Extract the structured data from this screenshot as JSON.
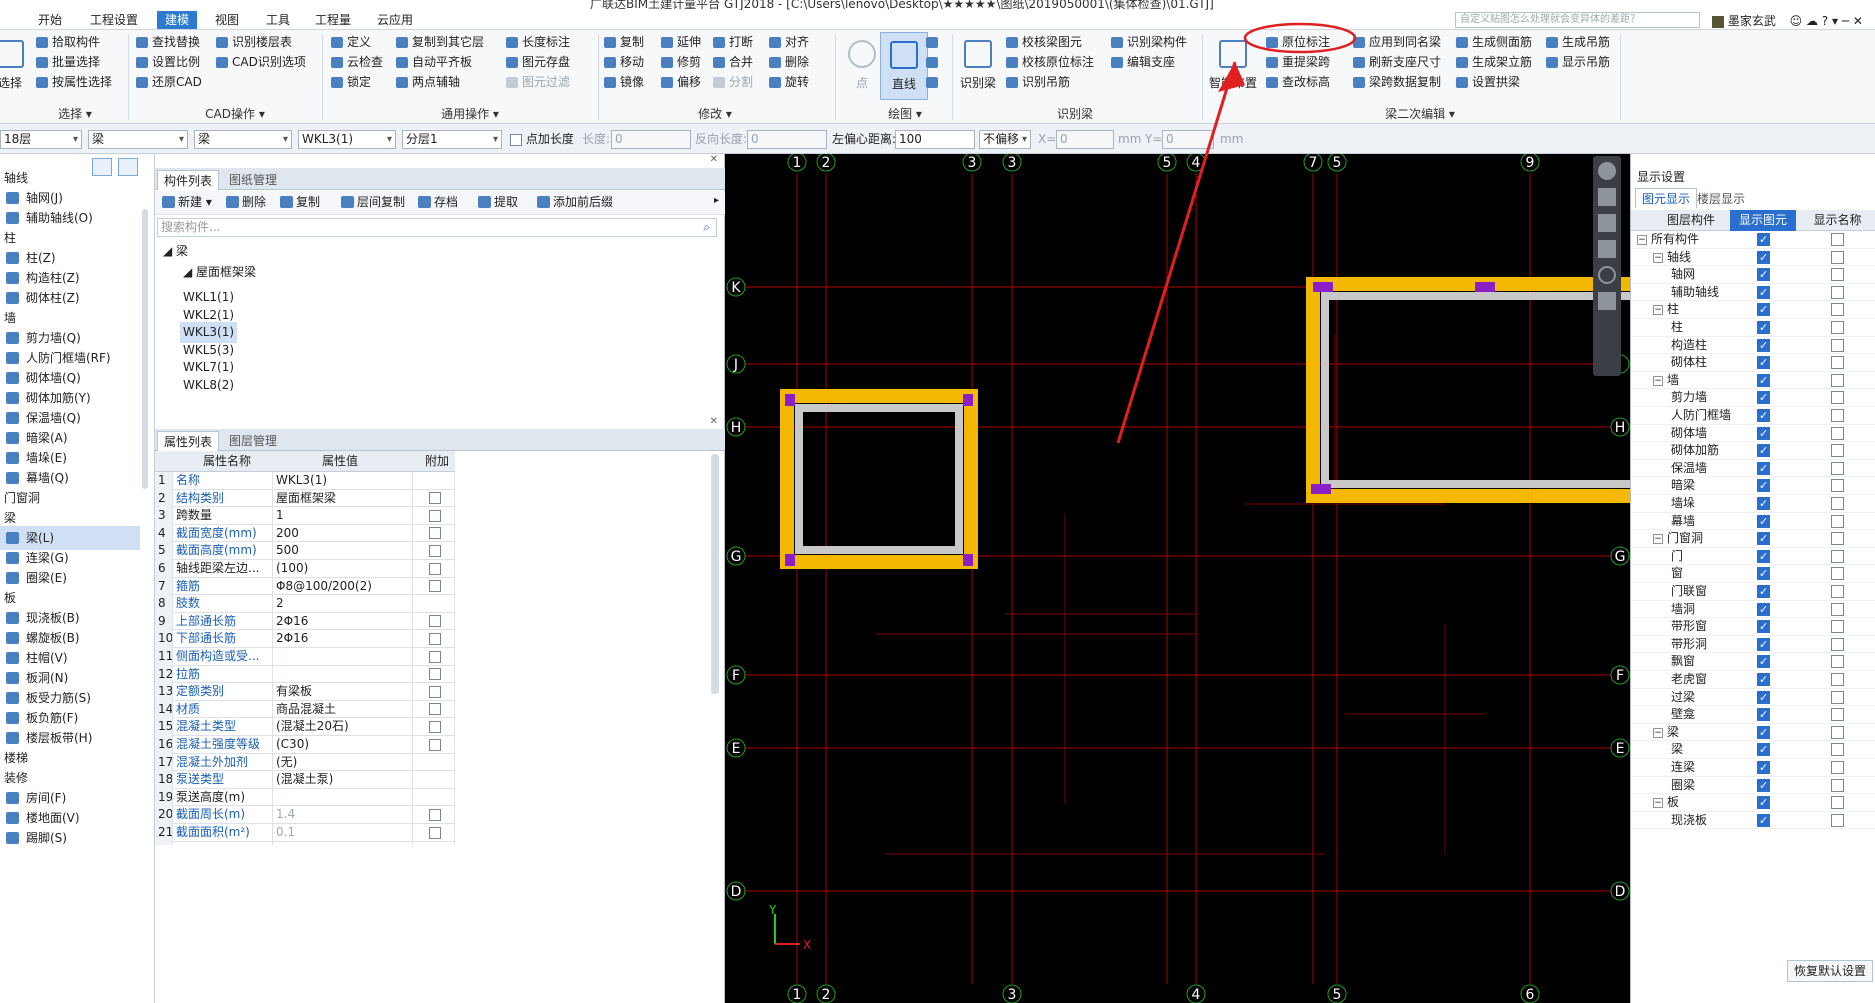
{
  "title_fragment": "广联达BIM土建计量平台 GTJ2018 - [C:\\Users\\lenovo\\Desktop\\★★★★★\\图纸\\2019050001\\(集体检查)\\01.GTJ]",
  "menu": {
    "tabs": [
      "开始",
      "工程设置",
      "建模",
      "视图",
      "工具",
      "工程量",
      "云应用"
    ],
    "active": "建模"
  },
  "search_placeholder": "自定义贴图怎么处理就会变异体的差距？",
  "user": "墨家玄武",
  "ribbon": {
    "select": {
      "big": "选择",
      "items": [
        "拾取构件",
        "批量选择",
        "按属性选择"
      ],
      "group": "选择"
    },
    "cad": {
      "items": [
        "查找替换",
        "设置比例",
        "还原CAD",
        "识别楼层表",
        "CAD识别选项"
      ],
      "group": "CAD操作"
    },
    "common": {
      "items": [
        "定义",
        "云检查",
        "锁定",
        "复制到其它层",
        "自动平齐板",
        "两点辅轴",
        "长度标注",
        "图元存盘",
        "图元过滤"
      ],
      "group": "通用操作"
    },
    "modify": {
      "items": [
        "复制",
        "移动",
        "镜像",
        "延伸",
        "修剪",
        "偏移",
        "打断",
        "合并",
        "分割",
        "对齐",
        "删除",
        "旋转"
      ],
      "group": "修改"
    },
    "draw": {
      "point": "点",
      "line": "直线",
      "group": "绘图"
    },
    "recognize": {
      "big": "识别梁",
      "items": [
        "校核梁图元",
        "校核原位标注",
        "识别吊筋",
        "识别梁构件",
        "编辑支座"
      ],
      "group": "识别梁"
    },
    "beam2": {
      "big": "智能布置",
      "items": [
        "原位标注",
        "重提梁跨",
        "查改标高",
        "应用到同名梁",
        "刷新支座尺寸",
        "梁跨数据复制",
        "生成侧面筋",
        "生成架立筋",
        "设置拱梁",
        "生成吊筋",
        "显示吊筋"
      ],
      "group": "梁二次编辑"
    }
  },
  "selbar": {
    "floor": "18层",
    "type": "梁",
    "subtype": "梁",
    "component": "WKL3(1)",
    "layer": "分层1",
    "addlen_label": "点加长度",
    "len_label": "长度:",
    "len_value": "0",
    "revlen_label": "反向长度:",
    "revlen_value": "0",
    "offset_label": "左偏心距离:",
    "offset_value": "100",
    "nooffset": "不偏移",
    "x_label": "X=",
    "x_value": "0",
    "y_label": "Y=",
    "y_value": "0",
    "unit": "mm"
  },
  "nav": [
    {
      "t": "cat",
      "label": "轴线"
    },
    {
      "t": "item",
      "label": "轴网(J)"
    },
    {
      "t": "item",
      "label": "辅助轴线(O)"
    },
    {
      "t": "cat",
      "label": "柱"
    },
    {
      "t": "item",
      "label": "柱(Z)"
    },
    {
      "t": "item",
      "label": "构造柱(Z)"
    },
    {
      "t": "item",
      "label": "砌体柱(Z)"
    },
    {
      "t": "cat",
      "label": "墙"
    },
    {
      "t": "item",
      "label": "剪力墙(Q)"
    },
    {
      "t": "item",
      "label": "人防门框墙(RF)"
    },
    {
      "t": "item",
      "label": "砌体墙(Q)"
    },
    {
      "t": "item",
      "label": "砌体加筋(Y)"
    },
    {
      "t": "item",
      "label": "保温墙(Q)"
    },
    {
      "t": "item",
      "label": "暗梁(A)"
    },
    {
      "t": "item",
      "label": "墙垛(E)"
    },
    {
      "t": "item",
      "label": "幕墙(Q)"
    },
    {
      "t": "cat",
      "label": "门窗洞"
    },
    {
      "t": "cat",
      "label": "梁"
    },
    {
      "t": "item",
      "label": "梁(L)",
      "sel": true
    },
    {
      "t": "item",
      "label": "连梁(G)"
    },
    {
      "t": "item",
      "label": "圈梁(E)"
    },
    {
      "t": "cat",
      "label": "板"
    },
    {
      "t": "item",
      "label": "现浇板(B)"
    },
    {
      "t": "item",
      "label": "螺旋板(B)"
    },
    {
      "t": "item",
      "label": "柱帽(V)"
    },
    {
      "t": "item",
      "label": "板洞(N)"
    },
    {
      "t": "item",
      "label": "板受力筋(S)"
    },
    {
      "t": "item",
      "label": "板负筋(F)"
    },
    {
      "t": "item",
      "label": "楼层板带(H)"
    },
    {
      "t": "cat",
      "label": "楼梯"
    },
    {
      "t": "cat",
      "label": "装修"
    },
    {
      "t": "item",
      "label": "房间(F)"
    },
    {
      "t": "item",
      "label": "楼地面(V)"
    },
    {
      "t": "item",
      "label": "踢脚(S)"
    }
  ],
  "components": {
    "tabs": [
      "构件列表",
      "图纸管理"
    ],
    "toolbar": [
      "新建",
      "删除",
      "复制",
      "层间复制",
      "存档",
      "提取",
      "添加前后缀"
    ],
    "search_placeholder": "搜索构件...",
    "root": "梁",
    "group": "屋面框架梁",
    "items": [
      "WKL1(1)",
      "WKL2(1)",
      "WKL3(1)",
      "WKL5(3)",
      "WKL7(1)",
      "WKL8(2)"
    ],
    "selected": "WKL3(1)"
  },
  "props": {
    "tabs": [
      "属性列表",
      "图层管理"
    ],
    "headers": [
      "属性名称",
      "属性值",
      "附加"
    ],
    "rows": [
      {
        "n": "1",
        "name": "名称",
        "val": "WKL3(1)",
        "blue": true,
        "chk": false
      },
      {
        "n": "2",
        "name": "结构类别",
        "val": "屋面框架梁",
        "blue": true,
        "chk": true
      },
      {
        "n": "3",
        "name": "跨数量",
        "val": "1",
        "blue": false,
        "chk": true
      },
      {
        "n": "4",
        "name": "截面宽度(mm)",
        "val": "200",
        "blue": true,
        "chk": true
      },
      {
        "n": "5",
        "name": "截面高度(mm)",
        "val": "500",
        "blue": true,
        "chk": true
      },
      {
        "n": "6",
        "name": "轴线距梁左边...",
        "val": "(100)",
        "blue": false,
        "chk": true
      },
      {
        "n": "7",
        "name": "箍筋",
        "val": "Φ8@100/200(2)",
        "blue": true,
        "chk": true
      },
      {
        "n": "8",
        "name": "肢数",
        "val": "2",
        "blue": true,
        "chk": false
      },
      {
        "n": "9",
        "name": "上部通长筋",
        "val": "2Φ16",
        "blue": true,
        "chk": true
      },
      {
        "n": "10",
        "name": "下部通长筋",
        "val": "2Φ16",
        "blue": true,
        "chk": true
      },
      {
        "n": "11",
        "name": "侧面构造或受...",
        "val": "",
        "blue": true,
        "chk": true
      },
      {
        "n": "12",
        "name": "拉筋",
        "val": "",
        "blue": true,
        "chk": true
      },
      {
        "n": "13",
        "name": "定额类别",
        "val": "有梁板",
        "blue": true,
        "chk": true
      },
      {
        "n": "14",
        "name": "材质",
        "val": "商品混凝土",
        "blue": true,
        "chk": true
      },
      {
        "n": "15",
        "name": "混凝土类型",
        "val": "(混凝土20石)",
        "blue": true,
        "chk": true
      },
      {
        "n": "16",
        "name": "混凝土强度等级",
        "val": "(C30)",
        "blue": true,
        "chk": true
      },
      {
        "n": "17",
        "name": "混凝土外加剂",
        "val": "(无)",
        "blue": true,
        "chk": false
      },
      {
        "n": "18",
        "name": "泵送类型",
        "val": "(混凝土泵)",
        "blue": true,
        "chk": false
      },
      {
        "n": "19",
        "name": "泵送高度(m)",
        "val": "",
        "blue": false,
        "chk": false
      },
      {
        "n": "20",
        "name": "截面周长(m)",
        "val": "1.4",
        "blue": true,
        "chk": true,
        "gray": true
      },
      {
        "n": "21",
        "name": "截面面积(m²)",
        "val": "0.1",
        "blue": true,
        "chk": true,
        "gray": true
      }
    ]
  },
  "canvas": {
    "axes_top": [
      "1",
      "2",
      "3",
      "3",
      "5",
      "4",
      "7",
      "5",
      "9"
    ],
    "axes_bottom": [
      "1",
      "2",
      "3",
      "4",
      "5",
      "6"
    ],
    "axes_left": [
      "K",
      "J",
      "H",
      "G",
      "F",
      "E",
      "D"
    ],
    "axes_right": [
      "J",
      "H",
      "G",
      "F",
      "E",
      "D"
    ],
    "coord_x": "X",
    "coord_y": "Y",
    "colors": {
      "axis": "#b00000",
      "beam": "#f5b800",
      "beam_inner": "#c8c8c8",
      "column": "#8a1fc8",
      "annotation": "#e02020",
      "label": "#ffffff"
    }
  },
  "display": {
    "title": "显示设置",
    "tabs": [
      "图元显示",
      "楼层显示"
    ],
    "headers": [
      "图层构件",
      "显示图元",
      "显示名称"
    ],
    "rows": [
      {
        "label": "所有构件",
        "lvl": 0,
        "exp": true,
        "show": true,
        "name": false
      },
      {
        "label": "轴线",
        "lvl": 1,
        "exp": true,
        "show": true,
        "name": false
      },
      {
        "label": "轴网",
        "lvl": 2,
        "show": true,
        "name": false
      },
      {
        "label": "辅助轴线",
        "lvl": 2,
        "show": true,
        "name": false
      },
      {
        "label": "柱",
        "lvl": 1,
        "exp": true,
        "show": true,
        "name": false
      },
      {
        "label": "柱",
        "lvl": 2,
        "show": true,
        "name": false
      },
      {
        "label": "构造柱",
        "lvl": 2,
        "show": true,
        "name": false
      },
      {
        "label": "砌体柱",
        "lvl": 2,
        "show": true,
        "name": false
      },
      {
        "label": "墙",
        "lvl": 1,
        "exp": true,
        "show": true,
        "name": false
      },
      {
        "label": "剪力墙",
        "lvl": 2,
        "show": true,
        "name": false
      },
      {
        "label": "人防门框墙",
        "lvl": 2,
        "show": true,
        "name": false
      },
      {
        "label": "砌体墙",
        "lvl": 2,
        "show": true,
        "name": false
      },
      {
        "label": "砌体加筋",
        "lvl": 2,
        "show": true,
        "name": false
      },
      {
        "label": "保温墙",
        "lvl": 2,
        "show": true,
        "name": false
      },
      {
        "label": "暗梁",
        "lvl": 2,
        "show": true,
        "name": false
      },
      {
        "label": "墙垛",
        "lvl": 2,
        "show": true,
        "name": false
      },
      {
        "label": "幕墙",
        "lvl": 2,
        "show": true,
        "name": false
      },
      {
        "label": "门窗洞",
        "lvl": 1,
        "exp": true,
        "show": true,
        "name": false
      },
      {
        "label": "门",
        "lvl": 2,
        "show": true,
        "name": false
      },
      {
        "label": "窗",
        "lvl": 2,
        "show": true,
        "name": false
      },
      {
        "label": "门联窗",
        "lvl": 2,
        "show": true,
        "name": false
      },
      {
        "label": "墙洞",
        "lvl": 2,
        "show": true,
        "name": false
      },
      {
        "label": "带形窗",
        "lvl": 2,
        "show": true,
        "name": false
      },
      {
        "label": "带形洞",
        "lvl": 2,
        "show": true,
        "name": false
      },
      {
        "label": "飘窗",
        "lvl": 2,
        "show": true,
        "name": false
      },
      {
        "label": "老虎窗",
        "lvl": 2,
        "show": true,
        "name": false
      },
      {
        "label": "过梁",
        "lvl": 2,
        "show": true,
        "name": false
      },
      {
        "label": "壁龛",
        "lvl": 2,
        "show": true,
        "name": false
      },
      {
        "label": "梁",
        "lvl": 1,
        "exp": true,
        "show": true,
        "name": false
      },
      {
        "label": "梁",
        "lvl": 2,
        "show": true,
        "name": false
      },
      {
        "label": "连梁",
        "lvl": 2,
        "show": true,
        "name": false
      },
      {
        "label": "圈梁",
        "lvl": 2,
        "show": true,
        "name": false
      },
      {
        "label": "板",
        "lvl": 1,
        "exp": true,
        "show": true,
        "name": false
      },
      {
        "label": "现浇板",
        "lvl": 2,
        "show": true,
        "name": false
      }
    ],
    "restore": "恢复默认设置"
  }
}
